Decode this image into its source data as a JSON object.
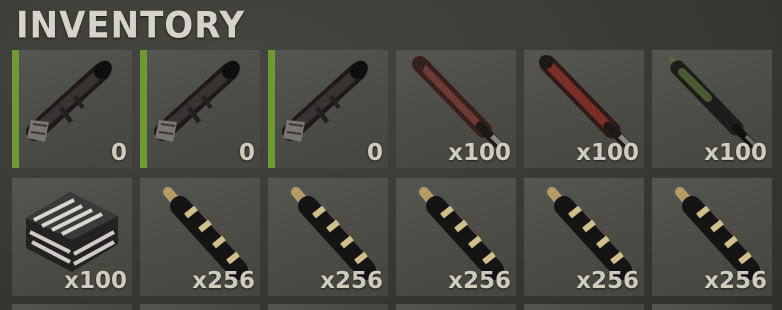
{
  "header": {
    "title": "INVENTORY"
  },
  "colors": {
    "equipped_bar": "#6e9a31",
    "slot_bg": "#4e4f48",
    "quantity_text": "#cfcac0"
  },
  "rows": [
    [
      {
        "icon": "rocket-launcher-icon",
        "quantity": "0",
        "equipped": true
      },
      {
        "icon": "rocket-launcher-icon",
        "quantity": "0",
        "equipped": true
      },
      {
        "icon": "rocket-launcher-icon",
        "quantity": "0",
        "equipped": true
      },
      {
        "icon": "rocket-icon",
        "quantity": "x100",
        "equipped": false
      },
      {
        "icon": "rocket-icon",
        "quantity": "x100",
        "equipped": false
      },
      {
        "icon": "hv-rocket-icon",
        "quantity": "x100",
        "equipped": false
      }
    ],
    [
      {
        "icon": "ammo-box-icon",
        "quantity": "x100",
        "equipped": false
      },
      {
        "icon": "rifle-ammo-icon",
        "quantity": "x256",
        "equipped": false
      },
      {
        "icon": "rifle-ammo-icon",
        "quantity": "x256",
        "equipped": false
      },
      {
        "icon": "rifle-ammo-icon",
        "quantity": "x256",
        "equipped": false
      },
      {
        "icon": "rifle-ammo-icon",
        "quantity": "x256",
        "equipped": false
      },
      {
        "icon": "rifle-ammo-icon",
        "quantity": "x256",
        "equipped": false
      }
    ]
  ]
}
